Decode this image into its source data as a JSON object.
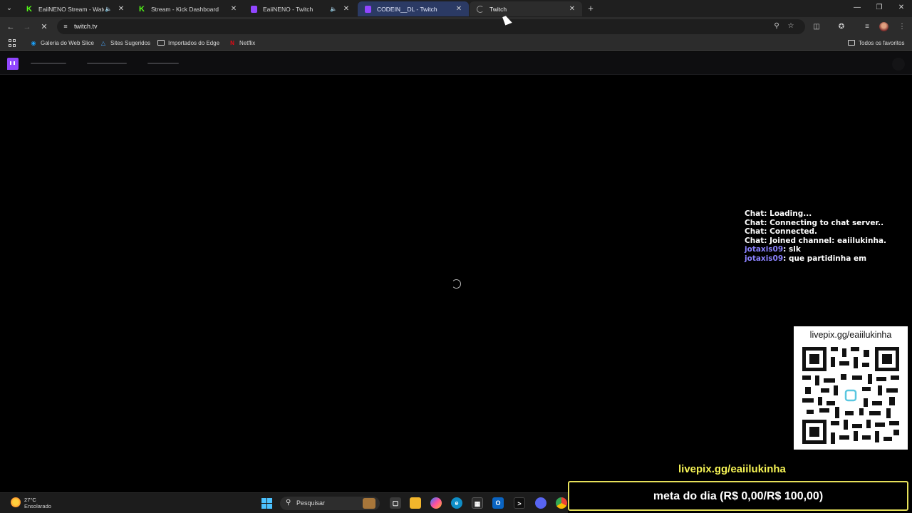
{
  "browser": {
    "tabs": [
      {
        "title": "EaiiNENO Stream - Watch L",
        "favicon": "kick-icon",
        "speaker": true,
        "active": false
      },
      {
        "title": "Stream - Kick Dashboard",
        "favicon": "kick-icon",
        "speaker": false,
        "active": false
      },
      {
        "title": "EaiiNENO - Twitch",
        "favicon": "twitch-icon",
        "speaker": true,
        "active": false
      },
      {
        "title": "CODEIN__DL - Twitch",
        "favicon": "twitch-icon",
        "speaker": false,
        "active": false
      },
      {
        "title": "Twitch",
        "favicon": "loading-icon",
        "speaker": false,
        "active": true
      }
    ],
    "address": {
      "url": "twitch.tv"
    },
    "bookmarks": [
      {
        "label": "Galeria do Web Slice",
        "icon": "web-slice-icon"
      },
      {
        "label": "Sites Sugeridos",
        "icon": "suggested-sites-icon"
      },
      {
        "label": "Importados do Edge",
        "icon": "folder-icon"
      },
      {
        "label": "Netflix",
        "icon": "netflix-icon"
      }
    ],
    "all_favorites": "Todos os favoritos"
  },
  "overlay": {
    "chat": [
      {
        "user": "",
        "text": "Chat: Loading..."
      },
      {
        "user": "",
        "text": "Chat: Connecting to chat server.."
      },
      {
        "user": "",
        "text": "Chat: Connected."
      },
      {
        "user": "",
        "text": "Chat: Joined channel: eaiilukinha."
      },
      {
        "user": "jotaxis09",
        "text": ": slk"
      },
      {
        "user": "jotaxis09",
        "text": ": que partidinha em"
      }
    ],
    "qr_url": "livepix.gg/eaiilukinha",
    "livepix_link": "livepix.gg/eaiilukinha",
    "goal": {
      "label": "meta do dia (R$ 0,00/R$ 100,00)",
      "current": 0,
      "target": 100,
      "fill_color": "#e6e15a"
    }
  },
  "taskbar": {
    "weather": {
      "temp": "27°C",
      "condition": "Ensolarado"
    },
    "search_placeholder": "Pesquisar"
  },
  "colors": {
    "twitch_purple": "#9146ff",
    "kick_green": "#53fc18",
    "chat_username": "#8b82ff",
    "livepix_yellow": "#f6f455"
  }
}
